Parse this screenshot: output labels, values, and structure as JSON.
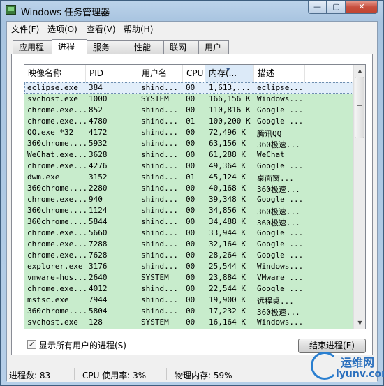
{
  "window": {
    "title": "Windows 任务管理器",
    "min_glyph": "—",
    "max_glyph": "▢",
    "close_glyph": "✕"
  },
  "menu": [
    "文件(F)",
    "选项(O)",
    "查看(V)",
    "帮助(H)"
  ],
  "tabs": [
    "应用程序",
    "进程",
    "服务",
    "性能",
    "联网",
    "用户"
  ],
  "active_tab": "进程",
  "columns": [
    "映像名称",
    "PID",
    "用户名",
    "CPU",
    "内存(...",
    "描述"
  ],
  "rows": [
    [
      "eclipse.exe",
      "384",
      "shind...",
      "00",
      "1,613,...",
      "eclipse..."
    ],
    [
      "svchost.exe",
      "1000",
      "SYSTEM",
      "00",
      "166,156 K",
      "Windows..."
    ],
    [
      "chrome.exe...",
      "852",
      "shind...",
      "00",
      "110,816 K",
      "Google ..."
    ],
    [
      "chrome.exe...",
      "4780",
      "shind...",
      "01",
      "100,200 K",
      "Google ..."
    ],
    [
      "QQ.exe *32",
      "4172",
      "shind...",
      "00",
      "72,496 K",
      "腾讯QQ"
    ],
    [
      "360chrome....",
      "5932",
      "shind...",
      "00",
      "63,156 K",
      "360极速..."
    ],
    [
      "WeChat.exe...",
      "3628",
      "shind...",
      "00",
      "61,288 K",
      "WeChat"
    ],
    [
      "chrome.exe...",
      "4276",
      "shind...",
      "00",
      "49,364 K",
      "Google ..."
    ],
    [
      "dwm.exe",
      "3152",
      "shind...",
      "01",
      "45,124 K",
      "桌面窗..."
    ],
    [
      "360chrome....",
      "2280",
      "shind...",
      "00",
      "40,168 K",
      "360极速..."
    ],
    [
      "chrome.exe...",
      "940",
      "shind...",
      "00",
      "39,348 K",
      "Google ..."
    ],
    [
      "360chrome....",
      "1124",
      "shind...",
      "00",
      "34,856 K",
      "360极速..."
    ],
    [
      "360chrome....",
      "5844",
      "shind...",
      "00",
      "34,488 K",
      "360极速..."
    ],
    [
      "chrome.exe...",
      "5660",
      "shind...",
      "00",
      "33,944 K",
      "Google ..."
    ],
    [
      "chrome.exe...",
      "7288",
      "shind...",
      "00",
      "32,164 K",
      "Google ..."
    ],
    [
      "chrome.exe...",
      "7628",
      "shind...",
      "00",
      "28,264 K",
      "Google ..."
    ],
    [
      "explorer.exe",
      "3176",
      "shind...",
      "00",
      "25,544 K",
      "Windows..."
    ],
    [
      "vmware-hos...",
      "2640",
      "SYSTEM",
      "00",
      "23,884 K",
      "VMware ..."
    ],
    [
      "chrome.exe...",
      "4012",
      "shind...",
      "00",
      "22,544 K",
      "Google ..."
    ],
    [
      "mstsc.exe",
      "7944",
      "shind...",
      "00",
      "19,900 K",
      "远程桌..."
    ],
    [
      "360chrome....",
      "5804",
      "shind...",
      "00",
      "17,232 K",
      "360极速..."
    ],
    [
      "svchost.exe",
      "128",
      "SYSTEM",
      "00",
      "16,164 K",
      "Windows..."
    ]
  ],
  "scroll": {
    "up": "▲",
    "down": "▼"
  },
  "show_all_users": {
    "label": "显示所有用户的进程(S)",
    "checked": true,
    "mark": "✓"
  },
  "end_process_label": "结束进程(E)",
  "status": {
    "processes": "进程数: 83",
    "cpu": "CPU 使用率: 3%",
    "memory": "物理内存: 59%"
  },
  "watermark": {
    "line1": "运维网",
    "line2": "iyunv.com"
  }
}
